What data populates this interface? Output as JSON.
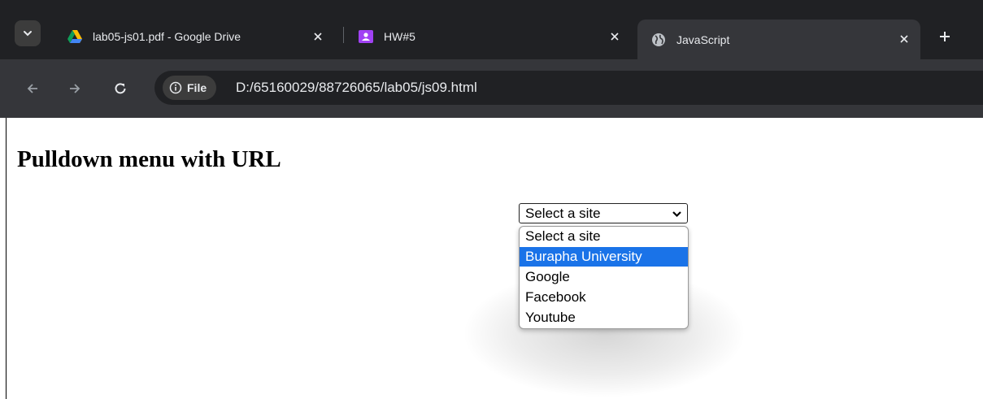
{
  "browser": {
    "tabs": [
      {
        "title": "lab05-js01.pdf - Google Drive",
        "favicon": "google-drive-icon",
        "active": false
      },
      {
        "title": "HW#5",
        "favicon": "classroom-assignment-icon",
        "active": false
      },
      {
        "title": "JavaScript",
        "favicon": "globe-icon",
        "active": true
      }
    ],
    "site_chip": "File",
    "url": "D:/65160029/88726065/lab05/js09.html",
    "colors": {
      "tabstrip": "#202124",
      "toolbar": "#35363a",
      "accent": "#1a73e8"
    }
  },
  "page": {
    "heading": "Pulldown menu with URL",
    "select": {
      "selected_value": "Select a site",
      "options": [
        "Select a site",
        "Burapha University",
        "Google",
        "Facebook",
        "Youtube"
      ],
      "highlighted_option": "Burapha University"
    }
  }
}
